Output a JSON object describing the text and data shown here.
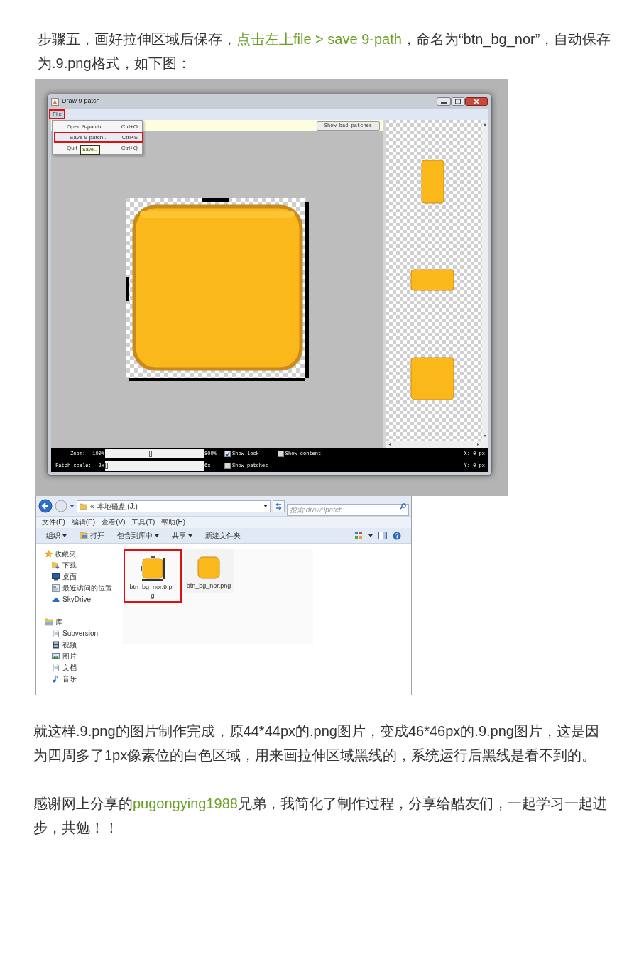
{
  "intro": {
    "segments": [
      {
        "text": "步骤五，画好拉伸区域后保存，",
        "kind": "text"
      },
      {
        "text": "点击左上file > save 9-path",
        "kind": "link"
      },
      {
        "text": "，命名为“btn_bg_nor”，自动保存为.9.png格式，如下图：",
        "kind": "text"
      }
    ]
  },
  "draw9patch": {
    "title": "Draw 9-patch",
    "menu": [
      {
        "label": "File",
        "selected": true
      }
    ],
    "file_menu": [
      {
        "label": "Open 9-patch...",
        "shortcut": "Ctrl+O",
        "selected": false
      },
      {
        "label": "Save 9-patch...",
        "shortcut": "Ctrl+S",
        "selected": true
      },
      {
        "label": "Quit",
        "shortcut": "Ctrl+Q",
        "selected": false
      }
    ],
    "tooltip": "Save...",
    "toolbar_button": "Show bad patches",
    "zoom": {
      "label": "Zoom:",
      "min": "100%",
      "max": "800%",
      "level": 0.46
    },
    "patch_scale": {
      "label": "Patch scale:",
      "min": "2x",
      "max": "6x",
      "level": 0
    },
    "checkboxes": [
      {
        "label": "Show lock",
        "checked": true
      },
      {
        "label": "Show content",
        "checked": false
      },
      {
        "label": "Show patches",
        "checked": false
      }
    ],
    "x_reading": "X: 0 px",
    "y_reading": "Y: 0 px"
  },
  "explorer": {
    "breadcrumb_chevron": "«",
    "address": "本地磁盘 (J:)",
    "search_placeholder": "搜索 draw9patch",
    "menu": [
      "文件(F)",
      "编辑(E)",
      "查看(V)",
      "工具(T)",
      "帮助(H)"
    ],
    "toolbar": [
      {
        "label": "组织",
        "kind": "dropdown"
      },
      {
        "label": "打开",
        "kind": "icon"
      },
      {
        "label": "包含到库中",
        "kind": "dropdown"
      },
      {
        "label": "共享",
        "kind": "dropdown"
      },
      {
        "label": "新建文件夹",
        "kind": "plain"
      }
    ],
    "sidebar": [
      {
        "label": "收藏夹",
        "children": [
          {
            "label": "下载"
          },
          {
            "label": "桌面"
          },
          {
            "label": "最近访问的位置"
          },
          {
            "label": "SkyDrive"
          }
        ]
      },
      {
        "label": "库",
        "children": [
          {
            "label": "Subversion"
          },
          {
            "label": "视频"
          },
          {
            "label": "图片"
          },
          {
            "label": "文档"
          },
          {
            "label": "音乐"
          }
        ]
      }
    ],
    "files": [
      {
        "name": "btn_bg_nor.9.png",
        "kind": "nine_patch",
        "selected": true
      },
      {
        "name": "btn_bg_nor.png",
        "kind": "png",
        "selected": false
      }
    ]
  },
  "body": [
    {
      "segments": [
        {
          "text": "就这样.9.png的图片制作完成，原44*44px的.png图片，变成46*46px的.9.png图片，这是因为四周多了1px像素位的白色区域，用来画拉伸区域黑线的，系统运行后黑线是看不到的。",
          "kind": "text"
        }
      ]
    },
    {
      "segments": [
        {
          "text": "感谢网上分享的",
          "kind": "text"
        },
        {
          "text": "pugongying1988",
          "kind": "link"
        },
        {
          "text": "兄弟，我简化了制作过程，分享给酷友们，一起学习一起进步，共勉！！",
          "kind": "text"
        }
      ]
    }
  ]
}
